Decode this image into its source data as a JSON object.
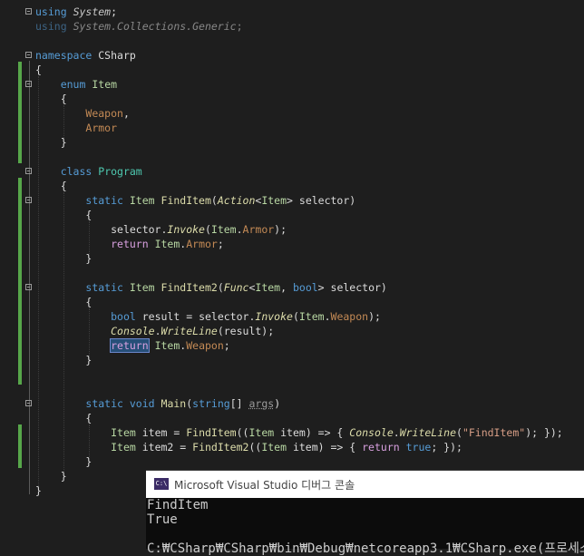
{
  "editor": {
    "using1": {
      "kw": "using",
      "ns": "System",
      "semi": ";"
    },
    "using2": {
      "kw": "using",
      "ns": "System.Collections.Generic",
      "semi": ";"
    },
    "ns_kw": "namespace",
    "ns_name": "CSharp",
    "enum_kw": "enum",
    "enum_name": "Item",
    "enum_member1": "Weapon",
    "enum_member2": "Armor",
    "class_kw": "class",
    "class_name": "Program",
    "static_kw": "static",
    "void_kw": "void",
    "return_kw": "return",
    "bool_kw": "bool",
    "true_kw": "true",
    "string_kw": "string",
    "findItem_name": "FindItem",
    "findItem2_name": "FindItem2",
    "action_type": "Action",
    "func_type": "Func",
    "selector_param": "selector",
    "invoke_name": "Invoke",
    "result_var": "result",
    "console_type": "Console",
    "writeline_name": "WriteLine",
    "main_name": "Main",
    "args_param": "args",
    "item_var": "item",
    "item2_var": "item2",
    "string_literal": "\"FindItem\""
  },
  "console": {
    "title": "Microsoft Visual Studio 디버그 콘솔",
    "icon_label": "C:\\",
    "output_lines": [
      "FindItem",
      "True"
    ],
    "path_line": "C:₩CSharp₩CSharp₩bin₩Debug₩netcoreapp3.1₩CSharp.exe(프로세스"
  }
}
